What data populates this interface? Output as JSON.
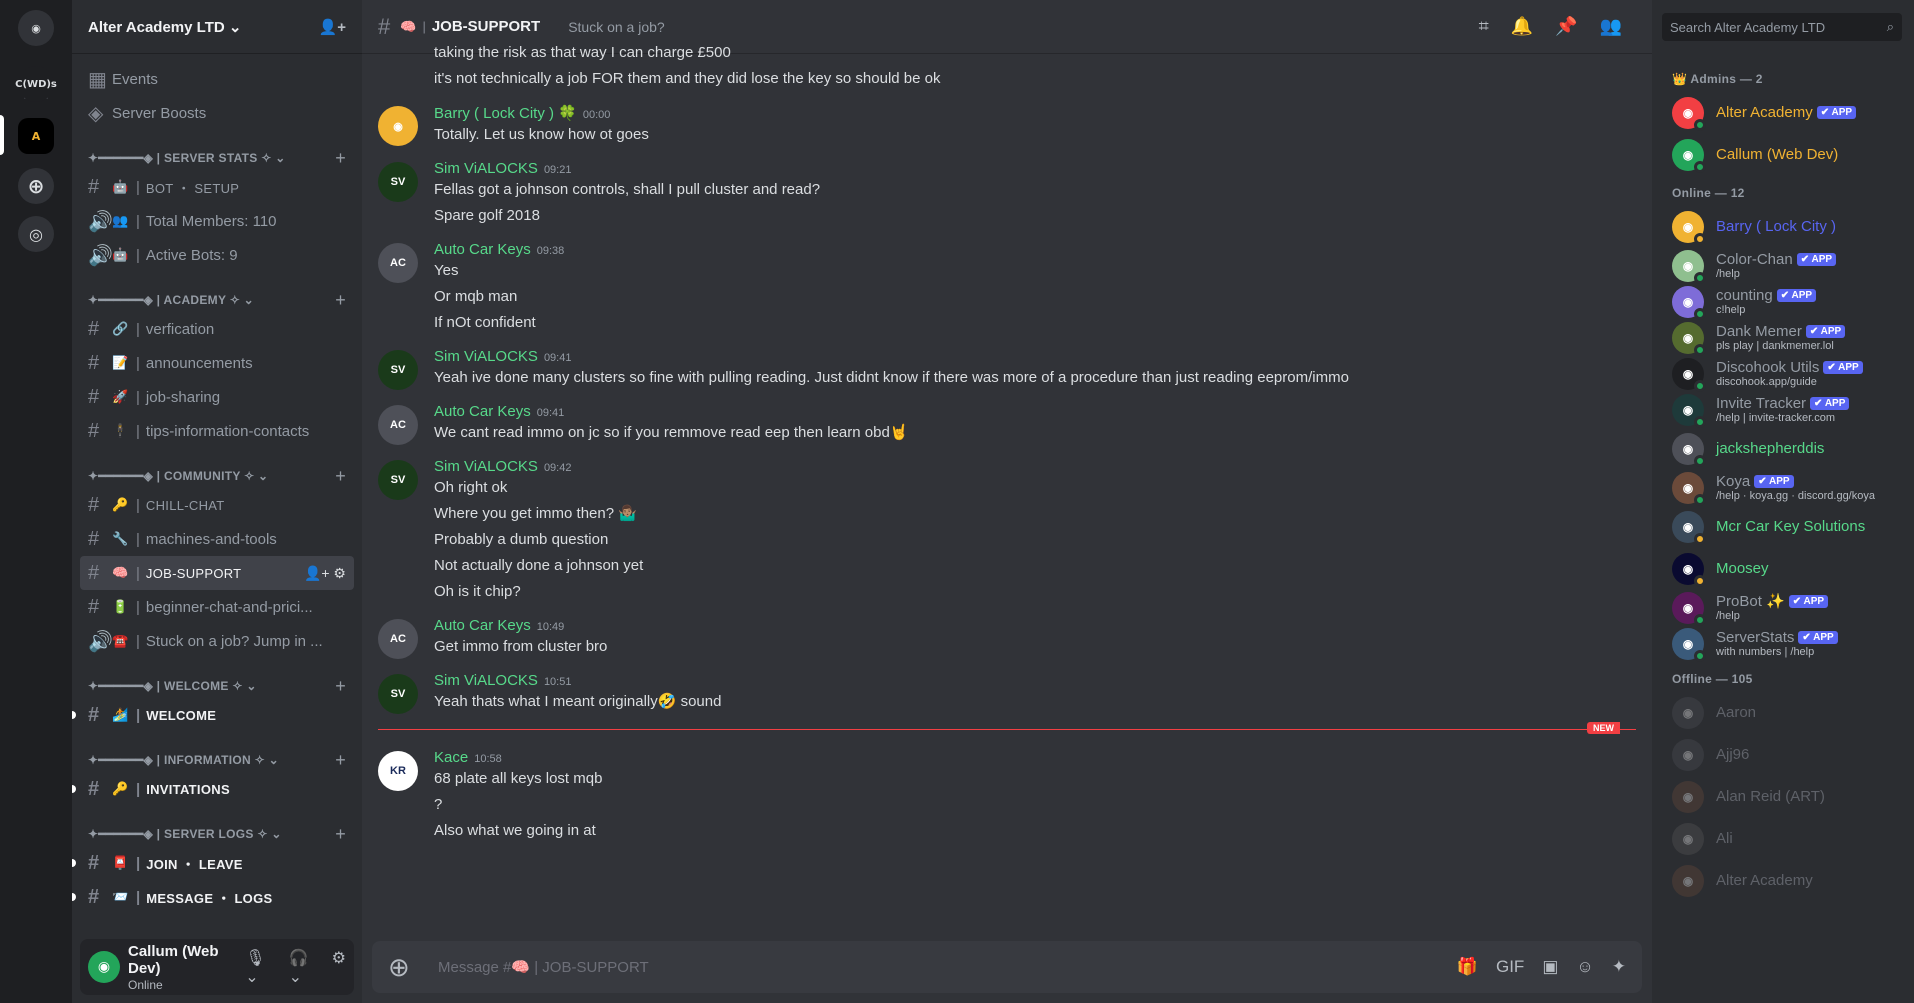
{
  "rail": {
    "servers": [
      "C(WD)s",
      "A"
    ],
    "icons": [
      "discord-home-icon",
      "add-server-icon",
      "discover-icon"
    ]
  },
  "guild": {
    "name": "Alter Academy LTD"
  },
  "sidebar": {
    "top_items": [
      "Events",
      "Server Boosts"
    ],
    "categories": [
      {
        "name": "✦━━━━━━◈ | SERVER STATS ✧",
        "channels": [
          {
            "emoji": "🤖",
            "name": "BOT ・ SETUP",
            "kind": "text",
            "sc": true
          },
          {
            "emoji": "👥",
            "name": "Total Members: 110",
            "kind": "voice"
          },
          {
            "emoji": "🤖",
            "name": "Active Bots: 9",
            "kind": "voice"
          }
        ]
      },
      {
        "name": "✦━━━━━━◈ | ACADEMY ✧",
        "channels": [
          {
            "emoji": "🔗",
            "name": "verfication",
            "kind": "text"
          },
          {
            "emoji": "📝",
            "name": "announcements",
            "kind": "text"
          },
          {
            "emoji": "🚀",
            "name": "job-sharing",
            "kind": "text"
          },
          {
            "emoji": "🕴",
            "name": "tips-information-contacts",
            "kind": "text"
          }
        ]
      },
      {
        "name": "✦━━━━━━◈ | COMMUNITY ✧",
        "channels": [
          {
            "emoji": "🔑",
            "name": "CHILL-CHAT",
            "kind": "text",
            "sc": true
          },
          {
            "emoji": "🔧",
            "name": "machines-and-tools",
            "kind": "text"
          },
          {
            "emoji": "🧠",
            "name": "JOB-SUPPORT",
            "kind": "text",
            "sc": true,
            "selected": true
          },
          {
            "emoji": "🔋",
            "name": "beginner-chat-and-prici...",
            "kind": "text"
          },
          {
            "emoji": "☎️",
            "name": "Stuck on a job? Jump in ...",
            "kind": "voice"
          }
        ]
      },
      {
        "name": "✦━━━━━━◈ | WELCOME ✧",
        "channels": [
          {
            "emoji": "🏄",
            "name": "WELCOME",
            "kind": "text",
            "sc": true,
            "unread": true
          }
        ]
      },
      {
        "name": "✦━━━━━━◈ | INFORMATION ✧",
        "channels": [
          {
            "emoji": "🔑",
            "name": "INVITATIONS",
            "kind": "text",
            "sc": true,
            "unread": true
          }
        ]
      },
      {
        "name": "✦━━━━━━◈ | SERVER LOGS ✧",
        "channels": [
          {
            "emoji": "📮",
            "name": "JOIN ・ LEAVE",
            "kind": "text",
            "sc": true,
            "unread": true
          },
          {
            "emoji": "📨",
            "name": "MESSAGE ・ LOGS",
            "kind": "text",
            "sc": true,
            "unread": true
          }
        ]
      }
    ]
  },
  "user": {
    "name": "Callum (Web Dev)",
    "status": "Online"
  },
  "topbar": {
    "channel": "JOB-SUPPORT",
    "topic": "Stuck on a job?"
  },
  "messages": [
    {
      "continuation": true,
      "lines": [
        "taking the risk as that way I can charge £500",
        "it's not technically a job FOR them and they did lose the key so should be ok"
      ]
    },
    {
      "author": "Barry ( Lock City ) 🍀",
      "time": "00:00",
      "avatar": "discord",
      "avatar_color": "#f0b232",
      "lines": [
        "Totally. Let us know how ot goes"
      ]
    },
    {
      "author": "Sim ViALOCKS",
      "time": "09:21",
      "avatar": "SV",
      "avatar_color": "#1a3a1a",
      "lines": [
        "Fellas got a johnson controls, shall I pull cluster and read?",
        "Spare golf 2018"
      ]
    },
    {
      "author": "Auto Car Keys",
      "time": "09:38",
      "avatar": "AC",
      "avatar_color": "#4e5058",
      "lines": [
        "Yes",
        "Or mqb man",
        "If nOt confident"
      ]
    },
    {
      "author": "Sim ViALOCKS",
      "time": "09:41",
      "avatar": "SV",
      "avatar_color": "#1a3a1a",
      "lines": [
        "Yeah ive done many clusters so fine with pulling reading. Just didnt know if there was more of a procedure than just reading eeprom/immo"
      ]
    },
    {
      "author": "Auto Car Keys",
      "time": "09:41",
      "avatar": "AC",
      "avatar_color": "#4e5058",
      "lines": [
        "We cant read immo on jc so if you remmove read eep then learn obd🤘"
      ]
    },
    {
      "author": "Sim ViALOCKS",
      "time": "09:42",
      "avatar": "SV",
      "avatar_color": "#1a3a1a",
      "lines": [
        "Oh right ok",
        "Where you get immo then? 🤷🏽‍♂️",
        "Probably a dumb question",
        "Not actually done a johnson yet",
        "Oh is it chip?"
      ]
    },
    {
      "author": "Auto Car Keys",
      "time": "10:49",
      "avatar": "AC",
      "avatar_color": "#4e5058",
      "lines": [
        "Get immo from cluster bro"
      ]
    },
    {
      "author": "Sim ViALOCKS",
      "time": "10:51",
      "avatar": "SV",
      "avatar_color": "#1a3a1a",
      "lines": [
        "Yeah thats what I meant originally🤣 sound"
      ]
    },
    {
      "author": "Kace",
      "time": "10:58",
      "avatar": "KR",
      "avatar_color": "#ffffff",
      "new": true,
      "lines": [
        "68 plate all keys lost mqb",
        "?",
        "Also what we going in at"
      ]
    }
  ],
  "new_label": "NEW",
  "composer": {
    "placeholder": "Message #🧠 | JOB-SUPPORT"
  },
  "search": {
    "placeholder": "Search Alter Academy LTD"
  },
  "members": {
    "groups": [
      {
        "title": "👑 Admins — 2",
        "items": [
          {
            "name": "Alter Academy",
            "app": true,
            "color": "#f0b232",
            "av": "#f23f43"
          },
          {
            "name": "Callum (Web Dev)",
            "color": "#f0b232",
            "av": "#23a55a"
          }
        ]
      },
      {
        "title": "Online — 12",
        "items": [
          {
            "name": "Barry ( Lock City )",
            "color": "#5865f2",
            "av": "#f0b232",
            "idle": true
          },
          {
            "name": "Color-Chan",
            "app": true,
            "sub": "/help",
            "color": "#949ba4",
            "av": "#8fbf8f"
          },
          {
            "name": "counting",
            "app": true,
            "sub": "c!help",
            "color": "#949ba4",
            "av": "#7e6cd8"
          },
          {
            "name": "Dank Memer",
            "app": true,
            "sub": "pls play | dankmemer.lol",
            "color": "#949ba4",
            "av": "#556b2f"
          },
          {
            "name": "Discohook Utils",
            "app": true,
            "sub": "discohook.app/guide",
            "color": "#949ba4",
            "av": "#1e1f22"
          },
          {
            "name": "Invite Tracker",
            "app": true,
            "sub": "/help | invite-tracker.com",
            "color": "#949ba4",
            "av": "#1e3a3a"
          },
          {
            "name": "jackshepherddis",
            "color": "#57d98a",
            "av": "#4e5058"
          },
          {
            "name": "Koya",
            "app": true,
            "sub": "/help · koya.gg · discord.gg/koya",
            "color": "#949ba4",
            "av": "#6b4a3a"
          },
          {
            "name": "Mcr Car Key Solutions",
            "color": "#57d98a",
            "av": "#3a4a5a",
            "idle": true
          },
          {
            "name": "Moosey",
            "color": "#57d98a",
            "av": "#0a0a30",
            "idle": true
          },
          {
            "name": "ProBot ✨",
            "app": true,
            "sub": "/help",
            "color": "#949ba4",
            "av": "#5a1a5a"
          },
          {
            "name": "ServerStats",
            "app": true,
            "sub": "with numbers | /help",
            "color": "#949ba4",
            "av": "#3a5a7a"
          }
        ]
      },
      {
        "title": "Offline — 105",
        "offline": true,
        "items": [
          {
            "name": "Aaron",
            "av": "#4e5058"
          },
          {
            "name": "Ajj96",
            "av": "#4e5058"
          },
          {
            "name": "Alan Reid (ART)",
            "av": "#6b4a3a"
          },
          {
            "name": "Ali",
            "av": "#5a5a5a"
          },
          {
            "name": "Alter Academy",
            "av": "#6b4a3a"
          }
        ]
      }
    ],
    "app_label": "✔ APP"
  }
}
